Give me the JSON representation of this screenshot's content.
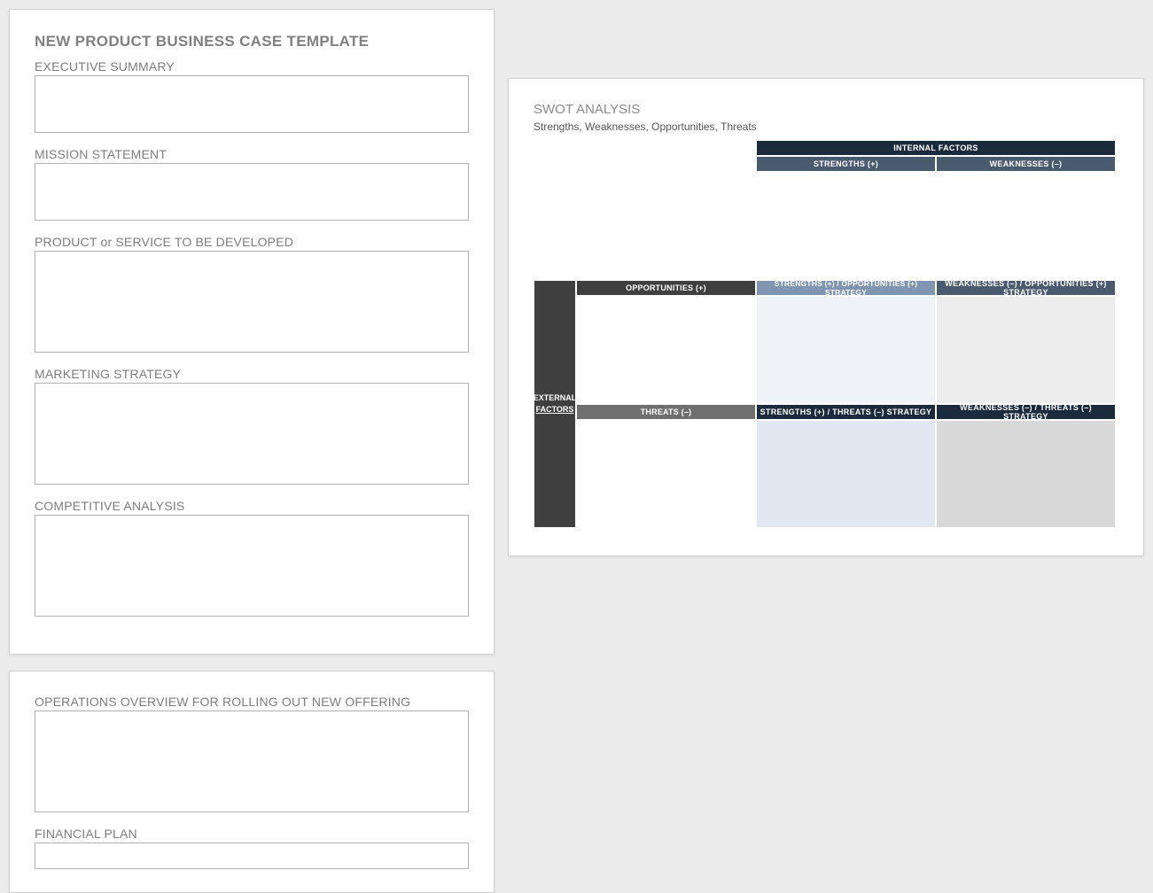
{
  "doc_title": "NEW PRODUCT BUSINESS CASE TEMPLATE",
  "sections": {
    "exec_summary": {
      "label": "EXECUTIVE SUMMARY",
      "value": ""
    },
    "mission": {
      "label": "MISSION STATEMENT",
      "value": ""
    },
    "product": {
      "label": "PRODUCT or SERVICE TO BE DEVELOPED",
      "value": ""
    },
    "marketing": {
      "label": "MARKETING STRATEGY",
      "value": ""
    },
    "competitive": {
      "label": "COMPETITIVE ANALYSIS",
      "value": ""
    },
    "operations": {
      "label": "OPERATIONS OVERVIEW FOR ROLLING OUT NEW OFFERING",
      "value": ""
    },
    "financial": {
      "label": "FINANCIAL PLAN",
      "value": ""
    }
  },
  "swot": {
    "title": "SWOT ANALYSIS",
    "subtitle": "Strengths, Weaknesses, Opportunities, Threats",
    "headers": {
      "internal": "INTERNAL   FACTORS",
      "external_l1": "EXTERNAL",
      "external_l2": "FACTORS",
      "strengths": "STRENGTHS (+)",
      "weaknesses": "WEAKNESSES (–)",
      "opportunities": "OPPORTUNITIES (+)",
      "threats": "THREATS (–)",
      "s_o": "STRENGTHS (+) / OPPORTUNITIES (+) STRATEGY",
      "w_o": "WEAKNESSES (–) / OPPORTUNITIES (+) STRATEGY",
      "s_t": "STRENGTHS (+) / THREATS (–) STRATEGY",
      "w_t": "WEAKNESSES (–) / THREATS (–) STRATEGY"
    },
    "cells": {
      "strengths": "",
      "weaknesses": "",
      "opportunities": "",
      "s_o": "",
      "w_o": "",
      "threats": "",
      "s_t": "",
      "w_t": ""
    }
  }
}
